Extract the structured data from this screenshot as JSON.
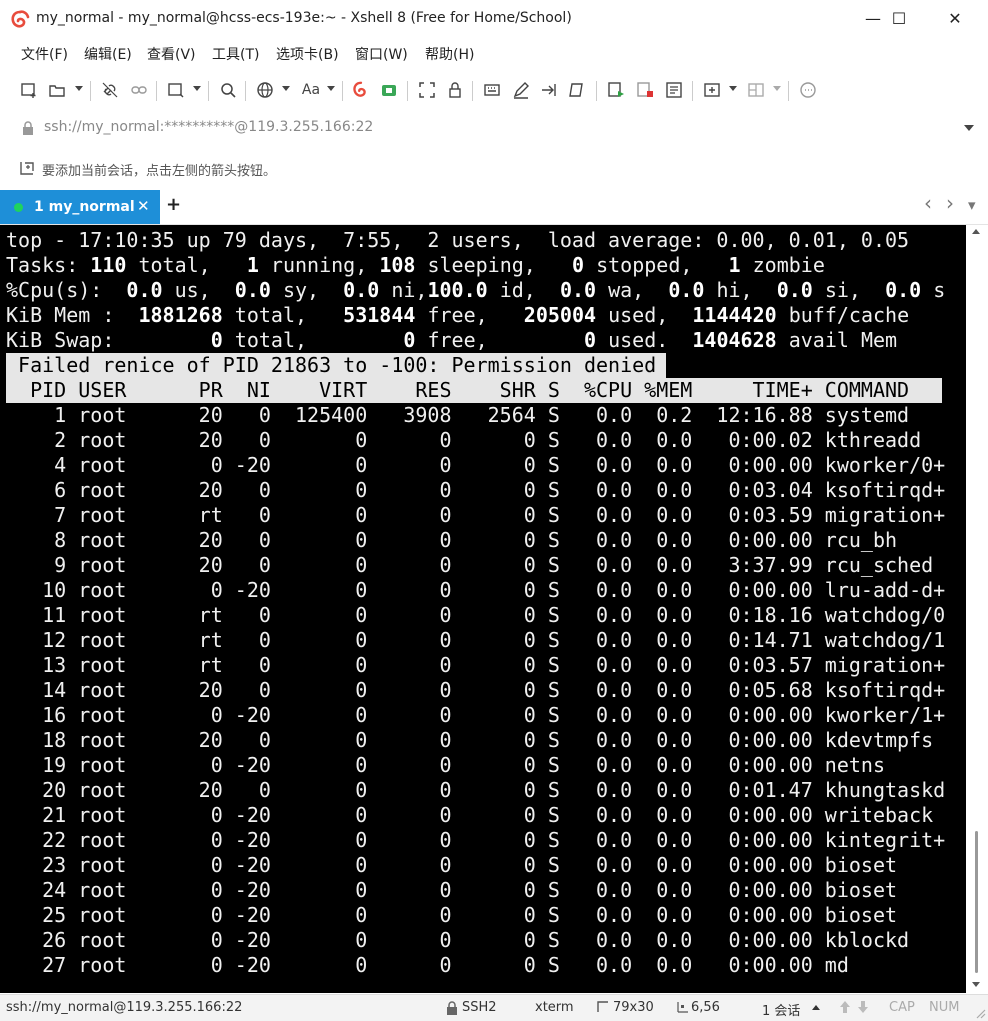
{
  "window": {
    "title": "my_normal - my_normal@hcss-ecs-193e:~ - Xshell 8 (Free for Home/School)",
    "minimize": "—",
    "maximize": "☐",
    "close": "✕"
  },
  "menu": [
    "文件(F)",
    "编辑(E)",
    "查看(V)",
    "工具(T)",
    "选项卡(B)",
    "窗口(W)",
    "帮助(H)"
  ],
  "toolbar": {
    "font_label": "Aa"
  },
  "address": {
    "value": "ssh://my_normal:**********@119.3.255.166:22"
  },
  "hint": {
    "text": "要添加当前会话，点击左侧的箭头按钮。"
  },
  "tabs": {
    "active_label": "1 my_normal",
    "close": "✕",
    "add": "+",
    "prev": "‹",
    "next": "›",
    "list": "▾"
  },
  "terminal": {
    "top": {
      "t0": "top - 17:10:35 up 79 days,  7:55,  2 users,  load average: 0.00, 0.01, 0.05",
      "tasks_a": "Tasks: ",
      "tasks_total": "110",
      "tasks_b": " total,   ",
      "tasks_running": "1",
      "tasks_c": " running, ",
      "tasks_sleeping": "108",
      "tasks_d": " sleeping,   ",
      "tasks_stopped": "0",
      "tasks_e": " stopped,   ",
      "tasks_zombie": "1",
      "tasks_f": " zombie",
      "cpu_a": "%Cpu(s):  ",
      "cpu_us": "0.0",
      "cpu_b": " us,  ",
      "cpu_sy": "0.0",
      "cpu_c": " sy,  ",
      "cpu_ni": "0.0",
      "cpu_d": " ni,",
      "cpu_id": "100.0",
      "cpu_e": " id,  ",
      "cpu_wa": "0.0",
      "cpu_f": " wa,  ",
      "cpu_hi": "0.0",
      "cpu_g": " hi,  ",
      "cpu_si": "0.0",
      "cpu_h": " si,  ",
      "cpu_st": "0.0",
      "cpu_i": " s",
      "mem_a": "KiB Mem :  ",
      "mem_total": "1881268",
      "mem_b": " total,   ",
      "mem_free": "531844",
      "mem_c": " free,   ",
      "mem_used": "205004",
      "mem_d": " used,  ",
      "mem_buff": "1144420",
      "mem_e": " buff/cache",
      "swap_a": "KiB Swap:        ",
      "swap_total": "0",
      "swap_b": " total,        ",
      "swap_free": "0",
      "swap_c": " free,        ",
      "swap_used": "0",
      "swap_d": " used.  ",
      "swap_avail": "1404628",
      "swap_e": " avail Mem"
    },
    "message": " Failed renice of PID 21863 to -100: Permission denied ",
    "header": "  PID USER      PR  NI    VIRT    RES    SHR S  %CPU %MEM     TIME+ COMMAND          ",
    "rows": [
      "    1 root      20   0  125400   3908   2564 S   0.0  0.2  12:16.88 systemd",
      "    2 root      20   0       0      0      0 S   0.0  0.0   0:00.02 kthreadd",
      "    4 root       0 -20       0      0      0 S   0.0  0.0   0:00.00 kworker/0+",
      "    6 root      20   0       0      0      0 S   0.0  0.0   0:03.04 ksoftirqd+",
      "    7 root      rt   0       0      0      0 S   0.0  0.0   0:03.59 migration+",
      "    8 root      20   0       0      0      0 S   0.0  0.0   0:00.00 rcu_bh",
      "    9 root      20   0       0      0      0 S   0.0  0.0   3:37.99 rcu_sched",
      "   10 root       0 -20       0      0      0 S   0.0  0.0   0:00.00 lru-add-d+",
      "   11 root      rt   0       0      0      0 S   0.0  0.0   0:18.16 watchdog/0",
      "   12 root      rt   0       0      0      0 S   0.0  0.0   0:14.71 watchdog/1",
      "   13 root      rt   0       0      0      0 S   0.0  0.0   0:03.57 migration+",
      "   14 root      20   0       0      0      0 S   0.0  0.0   0:05.68 ksoftirqd+",
      "   16 root       0 -20       0      0      0 S   0.0  0.0   0:00.00 kworker/1+",
      "   18 root      20   0       0      0      0 S   0.0  0.0   0:00.00 kdevtmpfs",
      "   19 root       0 -20       0      0      0 S   0.0  0.0   0:00.00 netns",
      "   20 root      20   0       0      0      0 S   0.0  0.0   0:01.47 khungtaskd",
      "   21 root       0 -20       0      0      0 S   0.0  0.0   0:00.00 writeback",
      "   22 root       0 -20       0      0      0 S   0.0  0.0   0:00.00 kintegrit+",
      "   23 root       0 -20       0      0      0 S   0.0  0.0   0:00.00 bioset",
      "   24 root       0 -20       0      0      0 S   0.0  0.0   0:00.00 bioset",
      "   25 root       0 -20       0      0      0 S   0.0  0.0   0:00.00 bioset",
      "   26 root       0 -20       0      0      0 S   0.0  0.0   0:00.00 kblockd",
      "   27 root       0 -20       0      0      0 S   0.0  0.0   0:00.00 md"
    ]
  },
  "status": {
    "connection": "ssh://my_normal@119.3.255.166:22",
    "protocol": "SSH2",
    "term": "xterm",
    "size": "79x30",
    "cursor": "6,56",
    "sessions": "1 会话",
    "caps": "CAP",
    "num": "NUM"
  },
  "colors": {
    "tab_accent": "#1e8fd8",
    "tab_dot": "#1fd35d",
    "terminal_bg": "#000000",
    "terminal_fg": "#f0f0f0",
    "highlight_bar": "#e6e6e6",
    "logo": "#e84c3d"
  }
}
